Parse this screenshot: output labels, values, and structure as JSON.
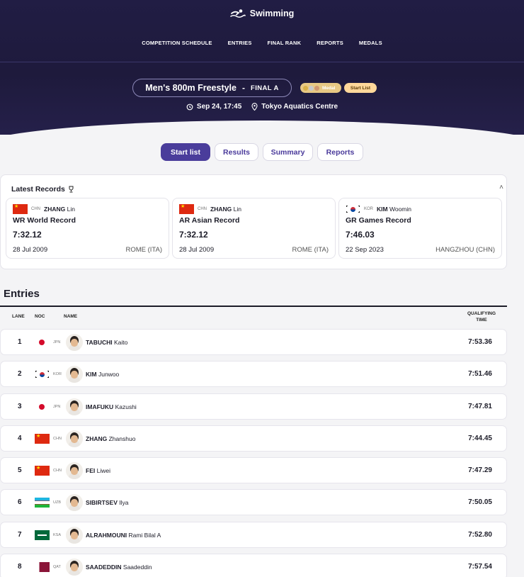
{
  "brand": {
    "name": "Swimming",
    "logo_icon": "swimmer-icon"
  },
  "nav": [
    "COMPETITION SCHEDULE",
    "ENTRIES",
    "FINAL RANK",
    "REPORTS",
    "MEDALS"
  ],
  "event": {
    "title": "Men's 800m Freestyle",
    "separator": "-",
    "phase": "FINAL A",
    "medal_tag": "Medal",
    "status_tag": "Start List",
    "datetime": "Sep 24, 17:45",
    "venue": "Tokyo Aquatics Centre"
  },
  "tabs": [
    "Start list",
    "Results",
    "Summary",
    "Reports"
  ],
  "records": {
    "heading": "Latest Records",
    "items": [
      {
        "noc": "CHN",
        "last": "ZHANG",
        "first": "Lin",
        "type": "WR  World Record",
        "time": "7:32.12",
        "date": "28 Jul 2009",
        "location": "ROME (ITA)"
      },
      {
        "noc": "CHN",
        "last": "ZHANG",
        "first": "Lin",
        "type": "AR  Asian Record",
        "time": "7:32.12",
        "date": "28 Jul 2009",
        "location": "ROME (ITA)"
      },
      {
        "noc": "KOR",
        "last": "KIM",
        "first": "Woomin",
        "type": "GR  Games Record",
        "time": "7:46.03",
        "date": "22 Sep 2023",
        "location": "HANGZHOU (CHN)"
      }
    ]
  },
  "entries": {
    "title": "Entries",
    "headers": {
      "lane": "LANE",
      "noc": "NOC",
      "name": "NAME",
      "qualifying_1": "QUALIFYING",
      "qualifying_2": "TIME"
    },
    "rows": [
      {
        "lane": "1",
        "noc": "JPN",
        "last": "TABUCHI",
        "first": "Kaito",
        "time": "7:53.36"
      },
      {
        "lane": "2",
        "noc": "KOR",
        "last": "KIM",
        "first": "Junwoo",
        "time": "7:51.46"
      },
      {
        "lane": "3",
        "noc": "JPN",
        "last": "IMAFUKU",
        "first": "Kazushi",
        "time": "7:47.81"
      },
      {
        "lane": "4",
        "noc": "CHN",
        "last": "ZHANG",
        "first": "Zhanshuo",
        "time": "7:44.45"
      },
      {
        "lane": "5",
        "noc": "CHN",
        "last": "FEI",
        "first": "Liwei",
        "time": "7:47.29"
      },
      {
        "lane": "6",
        "noc": "UZB",
        "last": "SIBIRTSEV",
        "first": "Ilya",
        "time": "7:50.05"
      },
      {
        "lane": "7",
        "noc": "KSA",
        "last": "ALRAHMOUNI",
        "first": "Rami Bilal A",
        "time": "7:52.80"
      },
      {
        "lane": "8",
        "noc": "QAT",
        "last": "SAADEDDIN",
        "first": "Saadeddin",
        "time": "7:57.54"
      }
    ]
  },
  "colors": {
    "header_bg": "#1d1a3c",
    "accent": "#4a3d9b",
    "medal_tag": "#e7c884",
    "start_tag": "#ffd89a"
  }
}
